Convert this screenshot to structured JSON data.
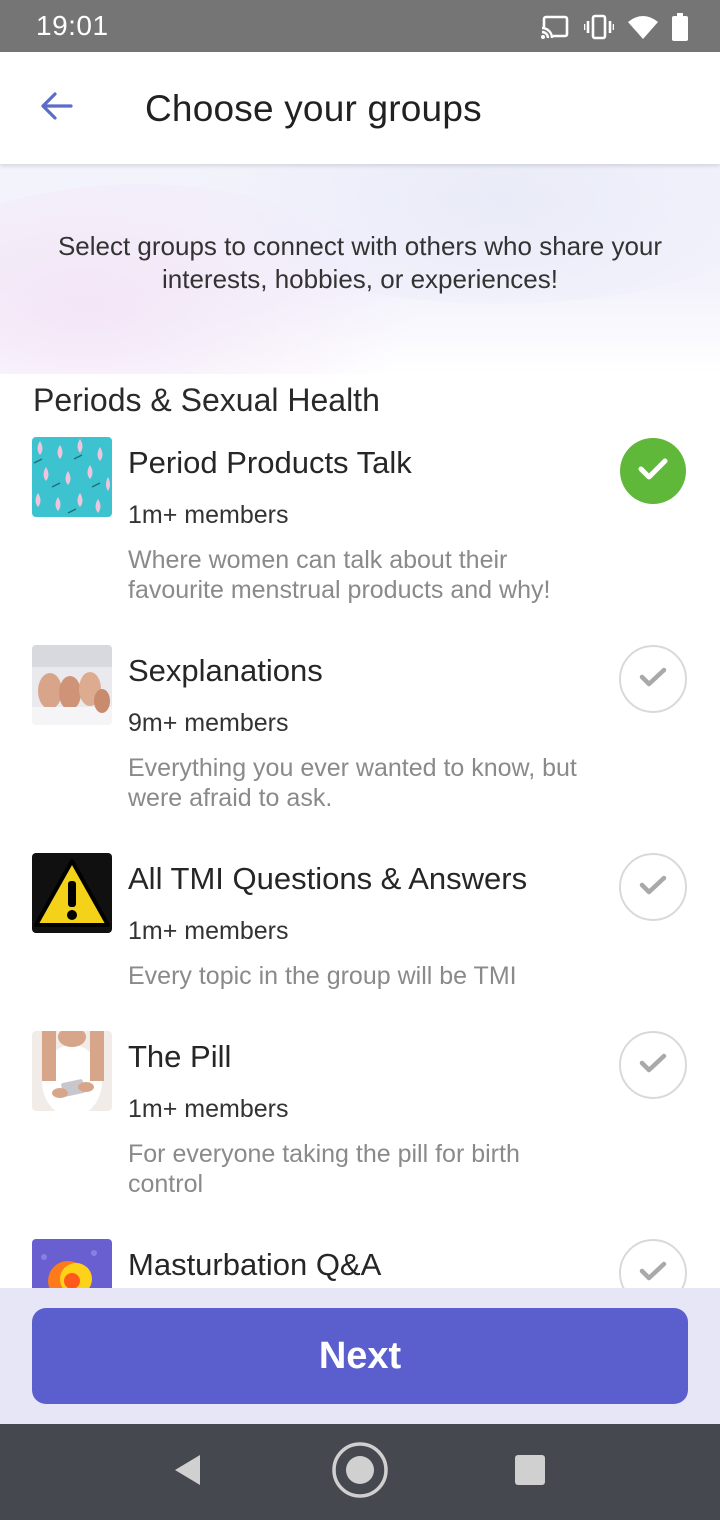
{
  "status_bar": {
    "time": "19:01",
    "icons": [
      "cast-icon",
      "vibrate-icon",
      "wifi-icon",
      "battery-icon"
    ]
  },
  "header": {
    "back_icon": "arrow-left-icon",
    "title": "Choose your groups"
  },
  "intro": {
    "text": "Select groups to connect with others who share your interests, hobbies, or experiences!"
  },
  "section": {
    "title": "Periods & Sexual Health"
  },
  "groups": [
    {
      "name": "Period Products Talk",
      "members": "1m+ members",
      "description": "Where women can talk about their favourite menstrual products and why!",
      "selected": true
    },
    {
      "name": "Sexplanations",
      "members": "9m+ members",
      "description": "Everything you ever wanted to know, but were afraid to ask.",
      "selected": false
    },
    {
      "name": "All TMI Questions & Answers",
      "members": "1m+ members",
      "description": "Every topic in the group will be TMI",
      "selected": false
    },
    {
      "name": "The Pill",
      "members": "1m+ members",
      "description": "For everyone taking the pill for birth control",
      "selected": false
    },
    {
      "name": "Masturbation Q&A",
      "members": "",
      "description": "",
      "selected": false
    }
  ],
  "footer": {
    "next_label": "Next"
  },
  "nav": {
    "icons": [
      "nav-back-icon",
      "nav-home-icon",
      "nav-recents-icon"
    ]
  },
  "colors": {
    "accent": "#5b5fce",
    "selected": "#5fb83a",
    "back_arrow": "#5b6cc9",
    "status_bar": "#757575",
    "nav_bar": "#45484f",
    "action_area": "#e6e6f6"
  }
}
